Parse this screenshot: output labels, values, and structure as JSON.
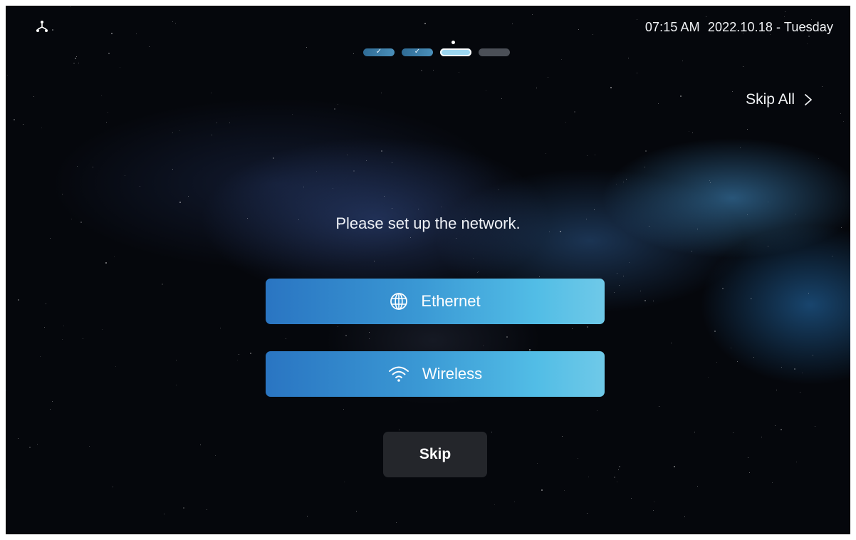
{
  "status_bar": {
    "network_icon": "network-topology-icon",
    "time": "07:15 AM",
    "date": "2022.10.18 - Tuesday"
  },
  "progress": {
    "total_steps": 4,
    "completed_steps": 2,
    "current_step": 3,
    "check_glyph": "✓"
  },
  "header": {
    "skip_all_label": "Skip All",
    "skip_all_icon": "chevron-right-icon"
  },
  "main": {
    "prompt": "Please set up the network.",
    "options": [
      {
        "label": "Ethernet",
        "icon": "globe-icon"
      },
      {
        "label": "Wireless",
        "icon": "wifi-icon"
      }
    ],
    "skip_label": "Skip"
  },
  "colors": {
    "background": "#05070c",
    "button_gradient_start": "#2a75c2",
    "button_gradient_end": "#6fc9e8",
    "skip_button": "#24262b",
    "step_done": "#3a6f95",
    "step_current": "#9cd6f0",
    "step_pending": "#4b4f57"
  }
}
